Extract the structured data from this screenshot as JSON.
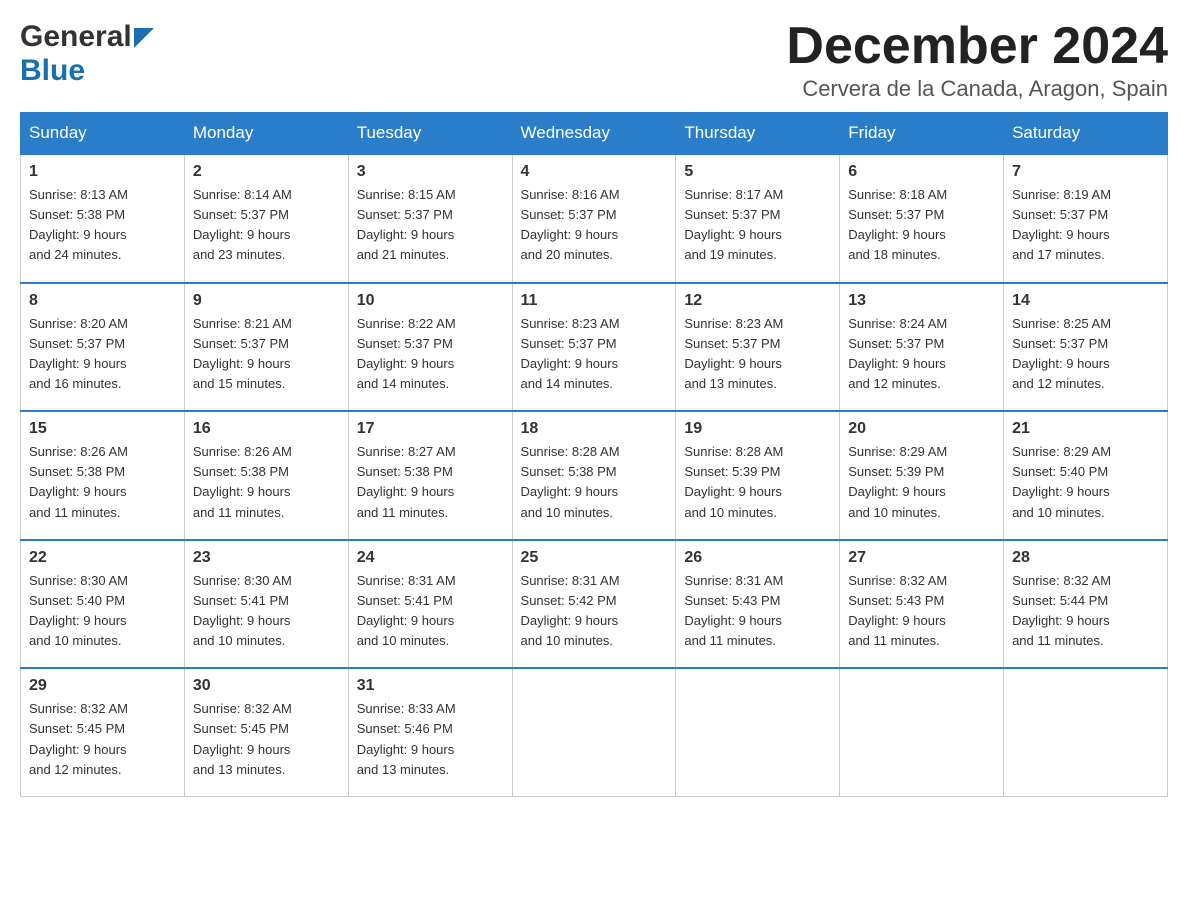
{
  "header": {
    "logo_general": "General",
    "logo_blue": "Blue",
    "month": "December 2024",
    "location": "Cervera de la Canada, Aragon, Spain"
  },
  "days_of_week": [
    "Sunday",
    "Monday",
    "Tuesday",
    "Wednesday",
    "Thursday",
    "Friday",
    "Saturday"
  ],
  "weeks": [
    [
      {
        "day": "1",
        "sunrise": "8:13 AM",
        "sunset": "5:38 PM",
        "daylight": "9 hours and 24 minutes."
      },
      {
        "day": "2",
        "sunrise": "8:14 AM",
        "sunset": "5:37 PM",
        "daylight": "9 hours and 23 minutes."
      },
      {
        "day": "3",
        "sunrise": "8:15 AM",
        "sunset": "5:37 PM",
        "daylight": "9 hours and 21 minutes."
      },
      {
        "day": "4",
        "sunrise": "8:16 AM",
        "sunset": "5:37 PM",
        "daylight": "9 hours and 20 minutes."
      },
      {
        "day": "5",
        "sunrise": "8:17 AM",
        "sunset": "5:37 PM",
        "daylight": "9 hours and 19 minutes."
      },
      {
        "day": "6",
        "sunrise": "8:18 AM",
        "sunset": "5:37 PM",
        "daylight": "9 hours and 18 minutes."
      },
      {
        "day": "7",
        "sunrise": "8:19 AM",
        "sunset": "5:37 PM",
        "daylight": "9 hours and 17 minutes."
      }
    ],
    [
      {
        "day": "8",
        "sunrise": "8:20 AM",
        "sunset": "5:37 PM",
        "daylight": "9 hours and 16 minutes."
      },
      {
        "day": "9",
        "sunrise": "8:21 AM",
        "sunset": "5:37 PM",
        "daylight": "9 hours and 15 minutes."
      },
      {
        "day": "10",
        "sunrise": "8:22 AM",
        "sunset": "5:37 PM",
        "daylight": "9 hours and 14 minutes."
      },
      {
        "day": "11",
        "sunrise": "8:23 AM",
        "sunset": "5:37 PM",
        "daylight": "9 hours and 14 minutes."
      },
      {
        "day": "12",
        "sunrise": "8:23 AM",
        "sunset": "5:37 PM",
        "daylight": "9 hours and 13 minutes."
      },
      {
        "day": "13",
        "sunrise": "8:24 AM",
        "sunset": "5:37 PM",
        "daylight": "9 hours and 12 minutes."
      },
      {
        "day": "14",
        "sunrise": "8:25 AM",
        "sunset": "5:37 PM",
        "daylight": "9 hours and 12 minutes."
      }
    ],
    [
      {
        "day": "15",
        "sunrise": "8:26 AM",
        "sunset": "5:38 PM",
        "daylight": "9 hours and 11 minutes."
      },
      {
        "day": "16",
        "sunrise": "8:26 AM",
        "sunset": "5:38 PM",
        "daylight": "9 hours and 11 minutes."
      },
      {
        "day": "17",
        "sunrise": "8:27 AM",
        "sunset": "5:38 PM",
        "daylight": "9 hours and 11 minutes."
      },
      {
        "day": "18",
        "sunrise": "8:28 AM",
        "sunset": "5:38 PM",
        "daylight": "9 hours and 10 minutes."
      },
      {
        "day": "19",
        "sunrise": "8:28 AM",
        "sunset": "5:39 PM",
        "daylight": "9 hours and 10 minutes."
      },
      {
        "day": "20",
        "sunrise": "8:29 AM",
        "sunset": "5:39 PM",
        "daylight": "9 hours and 10 minutes."
      },
      {
        "day": "21",
        "sunrise": "8:29 AM",
        "sunset": "5:40 PM",
        "daylight": "9 hours and 10 minutes."
      }
    ],
    [
      {
        "day": "22",
        "sunrise": "8:30 AM",
        "sunset": "5:40 PM",
        "daylight": "9 hours and 10 minutes."
      },
      {
        "day": "23",
        "sunrise": "8:30 AM",
        "sunset": "5:41 PM",
        "daylight": "9 hours and 10 minutes."
      },
      {
        "day": "24",
        "sunrise": "8:31 AM",
        "sunset": "5:41 PM",
        "daylight": "9 hours and 10 minutes."
      },
      {
        "day": "25",
        "sunrise": "8:31 AM",
        "sunset": "5:42 PM",
        "daylight": "9 hours and 10 minutes."
      },
      {
        "day": "26",
        "sunrise": "8:31 AM",
        "sunset": "5:43 PM",
        "daylight": "9 hours and 11 minutes."
      },
      {
        "day": "27",
        "sunrise": "8:32 AM",
        "sunset": "5:43 PM",
        "daylight": "9 hours and 11 minutes."
      },
      {
        "day": "28",
        "sunrise": "8:32 AM",
        "sunset": "5:44 PM",
        "daylight": "9 hours and 11 minutes."
      }
    ],
    [
      {
        "day": "29",
        "sunrise": "8:32 AM",
        "sunset": "5:45 PM",
        "daylight": "9 hours and 12 minutes."
      },
      {
        "day": "30",
        "sunrise": "8:32 AM",
        "sunset": "5:45 PM",
        "daylight": "9 hours and 13 minutes."
      },
      {
        "day": "31",
        "sunrise": "8:33 AM",
        "sunset": "5:46 PM",
        "daylight": "9 hours and 13 minutes."
      },
      null,
      null,
      null,
      null
    ]
  ],
  "labels": {
    "sunrise": "Sunrise:",
    "sunset": "Sunset:",
    "daylight": "Daylight:"
  }
}
